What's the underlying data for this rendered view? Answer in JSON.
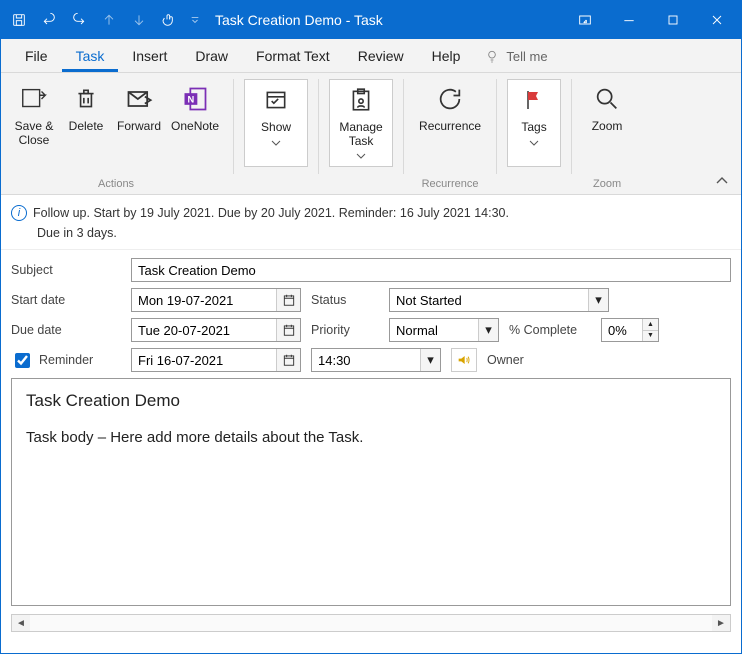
{
  "titlebar": {
    "title": "Task Creation Demo  -  Task"
  },
  "menu": {
    "items": [
      "File",
      "Task",
      "Insert",
      "Draw",
      "Format Text",
      "Review",
      "Help"
    ],
    "active_index": 1,
    "tellme": "Tell me"
  },
  "ribbon": {
    "actions": {
      "group_label": "Actions",
      "save_close": "Save &\nClose",
      "delete": "Delete",
      "forward": "Forward",
      "onenote": "OneNote"
    },
    "show": {
      "label": "Show"
    },
    "manage": {
      "group_label": "",
      "button": "Manage\nTask"
    },
    "recurrence": {
      "group_label": "Recurrence",
      "button": "Recurrence"
    },
    "tags": {
      "group_label": "",
      "button": "Tags"
    },
    "zoom": {
      "group_label": "Zoom",
      "button": "Zoom"
    }
  },
  "info": {
    "line1": "Follow up.  Start by 19 July 2021.  Due by 20 July 2021.  Reminder: 16 July 2021 14:30.",
    "line2": "Due in 3 days."
  },
  "form": {
    "subject_label": "Subject",
    "subject_value": "Task Creation Demo",
    "start_label": "Start date",
    "start_value": "Mon 19-07-2021",
    "due_label": "Due date",
    "due_value": "Tue 20-07-2021",
    "status_label": "Status",
    "status_value": "Not Started",
    "priority_label": "Priority",
    "priority_value": "Normal",
    "complete_label": "% Complete",
    "complete_value": "0%",
    "reminder_label": "Reminder",
    "reminder_date": "Fri 16-07-2021",
    "reminder_time": "14:30",
    "owner_label": "Owner"
  },
  "body": {
    "title": "Task Creation Demo",
    "text": "Task body – Here add more details about the Task."
  }
}
